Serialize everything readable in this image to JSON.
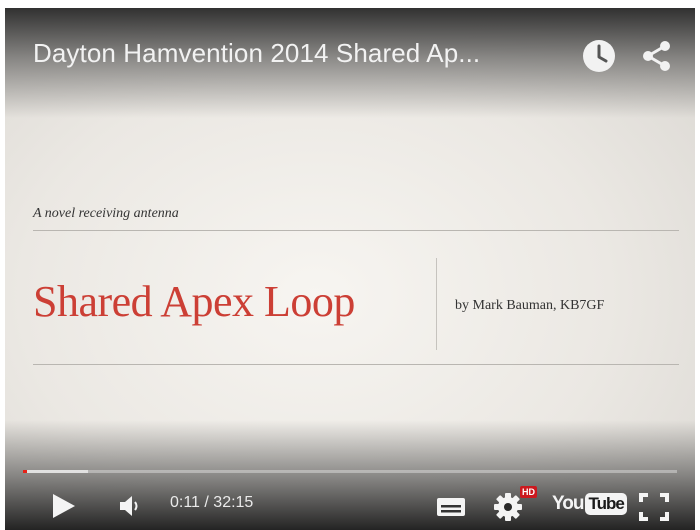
{
  "header": {
    "title": "Dayton Hamvention 2014 Shared Ap...",
    "watch_later_icon": "clock-icon",
    "share_icon": "share-icon"
  },
  "slide": {
    "subtitle": "A novel receiving antenna",
    "title": "Shared Apex Loop",
    "byline": "by Mark Bauman, KB7GF"
  },
  "controls": {
    "play_icon": "play-icon",
    "volume_icon": "volume-icon",
    "time": "0:11 / 32:15",
    "played_fraction": 0.006,
    "buffered_fraction": 0.1,
    "captions_icon": "captions-icon",
    "settings_icon": "gear-icon",
    "hd_badge": "HD",
    "logo_you": "You",
    "logo_tube": "Tube",
    "fullscreen_icon": "fullscreen-icon"
  },
  "colors": {
    "progress_played": "#e62117",
    "title_accent": "#cc3f35",
    "hd_badge": "#cc181e"
  }
}
